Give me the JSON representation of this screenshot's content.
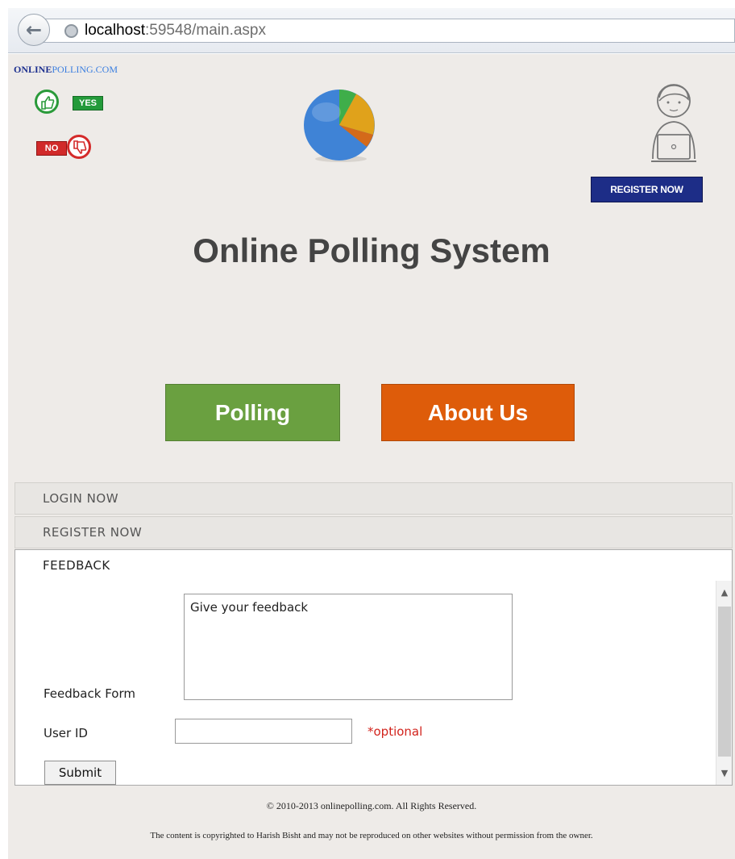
{
  "browser": {
    "url_host": "localhost",
    "url_rest": ":59548/main.aspx"
  },
  "header": {
    "brand_a": "ONLINE",
    "brand_b": "POLLING.COM",
    "yes_tag": "YES",
    "no_tag": "NO",
    "register_banner": "REGISTER NOW",
    "title": "Online Polling System"
  },
  "buttons": {
    "polling": "Polling",
    "about": "About Us"
  },
  "accordion": {
    "login": "LOGIN NOW",
    "register": "REGISTER NOW",
    "feedback": "FEEDBACK"
  },
  "feedback_form": {
    "label": "Feedback Form",
    "textarea_value": "Give your feedback",
    "user_id_label": "User ID",
    "user_id_value": "",
    "optional_text": "*optional",
    "submit": "Submit"
  },
  "footer": {
    "copyright": "© 2010-2013 onlinepolling.com. All Rights Reserved.",
    "notice": "The content is copyrighted to Harish Bisht and may not be reproduced on other websites without permission from the owner."
  },
  "colors": {
    "polling_button": "#6aa040",
    "about_button": "#de5c0a",
    "register_banner": "#1d2d87",
    "optional_text": "#d2231c"
  }
}
